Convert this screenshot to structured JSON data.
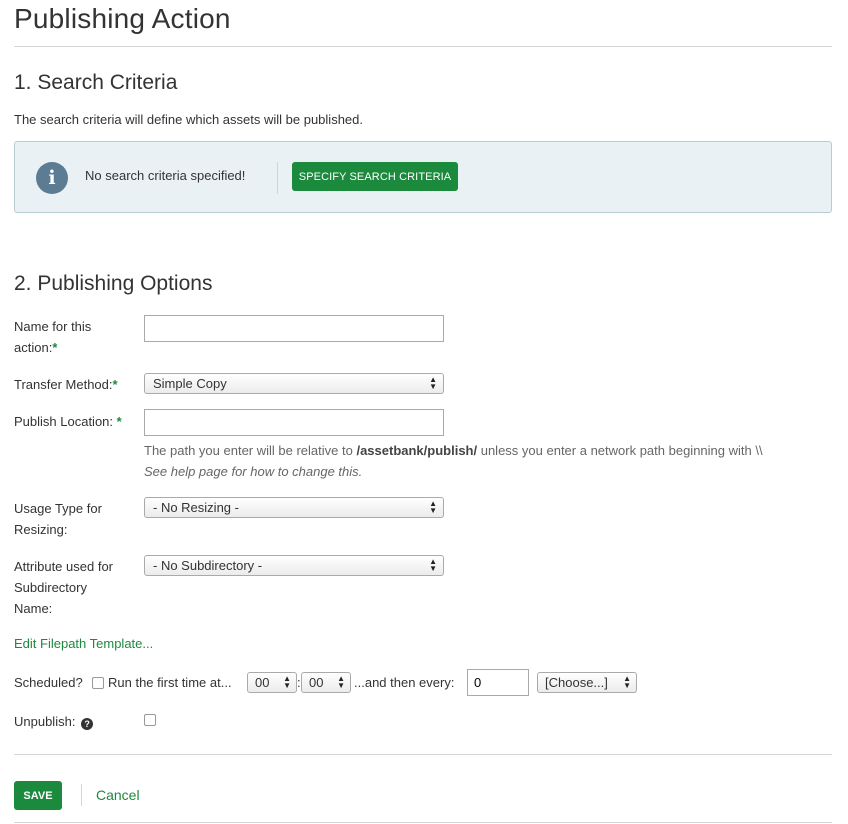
{
  "page": {
    "title": "Publishing Action"
  },
  "search": {
    "section_title": "1. Search Criteria",
    "intro": "The search criteria will define which assets will be published.",
    "alert_message": "No search criteria specified!",
    "specify_button": "Specify search criteria",
    "icon": "info-icon"
  },
  "options": {
    "section_title": "2. Publishing Options",
    "required_marker": "*",
    "name": {
      "label_line1": "Name for this",
      "label_line2": "action:",
      "value": ""
    },
    "transfer": {
      "label": "Transfer Method:",
      "selected": "Simple Copy"
    },
    "location": {
      "label": "Publish Location: ",
      "value": "",
      "hint_prefix": "The path you enter will be relative to ",
      "hint_path": "/assetbank/publish/",
      "hint_suffix": " unless you enter a network path beginning with \\\\",
      "hint_help": "See help page for how to change this."
    },
    "usage": {
      "label_line1": "Usage Type for",
      "label_line2": "Resizing:",
      "selected": "- No Resizing -"
    },
    "attribute": {
      "label_line1": "Attribute used for",
      "label_line2": "Subdirectory",
      "label_line3": "Name:",
      "selected": "- No Subdirectory -"
    },
    "edit_template_link": "Edit Filepath Template...",
    "schedule": {
      "label": "Scheduled?",
      "run_text": "Run the first time at...",
      "hour": "00",
      "colon": ":",
      "minute": "00",
      "then_text": "...and then every:",
      "every_value": "0",
      "unit_selected": "[Choose...]",
      "checked": false
    },
    "unpublish": {
      "label": "Unpublish:",
      "icon": "question-circle-icon",
      "checked": false
    }
  },
  "footer": {
    "save_label": "Save",
    "cancel_label": "Cancel"
  },
  "colors": {
    "accent": "#1c8a3c",
    "alert_bg": "#e9f1f5",
    "info_icon": "#5b7c93"
  }
}
